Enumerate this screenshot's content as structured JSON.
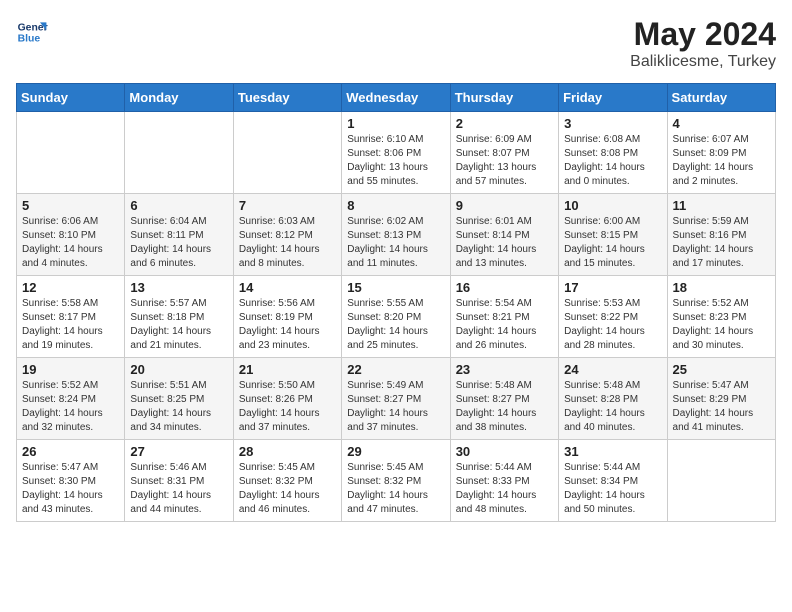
{
  "header": {
    "logo_line1": "General",
    "logo_line2": "Blue",
    "title": "May 2024",
    "subtitle": "Baliklicesme, Turkey"
  },
  "weekdays": [
    "Sunday",
    "Monday",
    "Tuesday",
    "Wednesday",
    "Thursday",
    "Friday",
    "Saturday"
  ],
  "weeks": [
    [
      {
        "day": "",
        "info": ""
      },
      {
        "day": "",
        "info": ""
      },
      {
        "day": "",
        "info": ""
      },
      {
        "day": "1",
        "info": "Sunrise: 6:10 AM\nSunset: 8:06 PM\nDaylight: 13 hours\nand 55 minutes."
      },
      {
        "day": "2",
        "info": "Sunrise: 6:09 AM\nSunset: 8:07 PM\nDaylight: 13 hours\nand 57 minutes."
      },
      {
        "day": "3",
        "info": "Sunrise: 6:08 AM\nSunset: 8:08 PM\nDaylight: 14 hours\nand 0 minutes."
      },
      {
        "day": "4",
        "info": "Sunrise: 6:07 AM\nSunset: 8:09 PM\nDaylight: 14 hours\nand 2 minutes."
      }
    ],
    [
      {
        "day": "5",
        "info": "Sunrise: 6:06 AM\nSunset: 8:10 PM\nDaylight: 14 hours\nand 4 minutes."
      },
      {
        "day": "6",
        "info": "Sunrise: 6:04 AM\nSunset: 8:11 PM\nDaylight: 14 hours\nand 6 minutes."
      },
      {
        "day": "7",
        "info": "Sunrise: 6:03 AM\nSunset: 8:12 PM\nDaylight: 14 hours\nand 8 minutes."
      },
      {
        "day": "8",
        "info": "Sunrise: 6:02 AM\nSunset: 8:13 PM\nDaylight: 14 hours\nand 11 minutes."
      },
      {
        "day": "9",
        "info": "Sunrise: 6:01 AM\nSunset: 8:14 PM\nDaylight: 14 hours\nand 13 minutes."
      },
      {
        "day": "10",
        "info": "Sunrise: 6:00 AM\nSunset: 8:15 PM\nDaylight: 14 hours\nand 15 minutes."
      },
      {
        "day": "11",
        "info": "Sunrise: 5:59 AM\nSunset: 8:16 PM\nDaylight: 14 hours\nand 17 minutes."
      }
    ],
    [
      {
        "day": "12",
        "info": "Sunrise: 5:58 AM\nSunset: 8:17 PM\nDaylight: 14 hours\nand 19 minutes."
      },
      {
        "day": "13",
        "info": "Sunrise: 5:57 AM\nSunset: 8:18 PM\nDaylight: 14 hours\nand 21 minutes."
      },
      {
        "day": "14",
        "info": "Sunrise: 5:56 AM\nSunset: 8:19 PM\nDaylight: 14 hours\nand 23 minutes."
      },
      {
        "day": "15",
        "info": "Sunrise: 5:55 AM\nSunset: 8:20 PM\nDaylight: 14 hours\nand 25 minutes."
      },
      {
        "day": "16",
        "info": "Sunrise: 5:54 AM\nSunset: 8:21 PM\nDaylight: 14 hours\nand 26 minutes."
      },
      {
        "day": "17",
        "info": "Sunrise: 5:53 AM\nSunset: 8:22 PM\nDaylight: 14 hours\nand 28 minutes."
      },
      {
        "day": "18",
        "info": "Sunrise: 5:52 AM\nSunset: 8:23 PM\nDaylight: 14 hours\nand 30 minutes."
      }
    ],
    [
      {
        "day": "19",
        "info": "Sunrise: 5:52 AM\nSunset: 8:24 PM\nDaylight: 14 hours\nand 32 minutes."
      },
      {
        "day": "20",
        "info": "Sunrise: 5:51 AM\nSunset: 8:25 PM\nDaylight: 14 hours\nand 34 minutes."
      },
      {
        "day": "21",
        "info": "Sunrise: 5:50 AM\nSunset: 8:26 PM\nDaylight: 14 hours\nand 37 minutes."
      },
      {
        "day": "22",
        "info": "Sunrise: 5:49 AM\nSunset: 8:27 PM\nDaylight: 14 hours\nand 37 minutes."
      },
      {
        "day": "23",
        "info": "Sunrise: 5:48 AM\nSunset: 8:27 PM\nDaylight: 14 hours\nand 38 minutes."
      },
      {
        "day": "24",
        "info": "Sunrise: 5:48 AM\nSunset: 8:28 PM\nDaylight: 14 hours\nand 40 minutes."
      },
      {
        "day": "25",
        "info": "Sunrise: 5:47 AM\nSunset: 8:29 PM\nDaylight: 14 hours\nand 41 minutes."
      }
    ],
    [
      {
        "day": "26",
        "info": "Sunrise: 5:47 AM\nSunset: 8:30 PM\nDaylight: 14 hours\nand 43 minutes."
      },
      {
        "day": "27",
        "info": "Sunrise: 5:46 AM\nSunset: 8:31 PM\nDaylight: 14 hours\nand 44 minutes."
      },
      {
        "day": "28",
        "info": "Sunrise: 5:45 AM\nSunset: 8:32 PM\nDaylight: 14 hours\nand 46 minutes."
      },
      {
        "day": "29",
        "info": "Sunrise: 5:45 AM\nSunset: 8:32 PM\nDaylight: 14 hours\nand 47 minutes."
      },
      {
        "day": "30",
        "info": "Sunrise: 5:44 AM\nSunset: 8:33 PM\nDaylight: 14 hours\nand 48 minutes."
      },
      {
        "day": "31",
        "info": "Sunrise: 5:44 AM\nSunset: 8:34 PM\nDaylight: 14 hours\nand 50 minutes."
      },
      {
        "day": "",
        "info": ""
      }
    ]
  ]
}
